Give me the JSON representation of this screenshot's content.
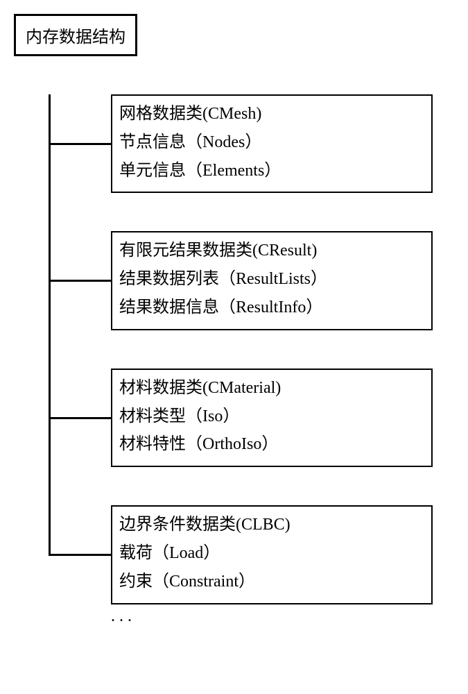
{
  "root": {
    "title": "内存数据结构"
  },
  "children": [
    {
      "lines": [
        "网格数据类(CMesh)",
        "节点信息（Nodes）",
        "单元信息（Elements）"
      ]
    },
    {
      "lines": [
        "有限元结果数据类(CResult)",
        "结果数据列表（ResultLists）",
        "结果数据信息（ResultInfo）"
      ]
    },
    {
      "lines": [
        "材料数据类(CMaterial)",
        "材料类型（Iso）",
        "材料特性（OrthoIso）"
      ]
    },
    {
      "lines": [
        "边界条件数据类(CLBC)",
        "载荷（Load）",
        "约束（Constraint）"
      ]
    }
  ],
  "ellipsis": ". . ."
}
